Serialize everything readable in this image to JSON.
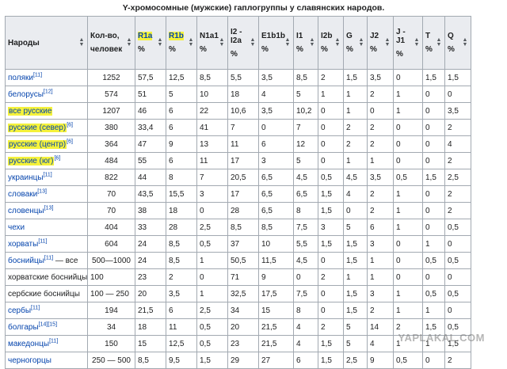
{
  "caption": "Y-хромосомные (мужские) гаплогруппы у славянских народов.",
  "headers": [
    {
      "label": "Народы",
      "unit": ""
    },
    {
      "label": "Кол-во,",
      "unit": "человек"
    },
    {
      "label": "R1a",
      "unit": "%",
      "highlight": true
    },
    {
      "label": "R1b",
      "unit": "%",
      "highlight": true
    },
    {
      "label": "N1a1",
      "unit": "%"
    },
    {
      "label": "I2 -",
      "label2": "I2a",
      "unit": "%"
    },
    {
      "label": "E1b1b",
      "unit": "%"
    },
    {
      "label": "I1",
      "unit": "%"
    },
    {
      "label": "I2b",
      "unit": "%"
    },
    {
      "label": "G",
      "unit": "%"
    },
    {
      "label": "J2",
      "unit": "%"
    },
    {
      "label": "J -",
      "label2": "J1",
      "unit": "%"
    },
    {
      "label": "T",
      "unit": "%"
    },
    {
      "label": "Q",
      "unit": "%"
    }
  ],
  "rows": [
    {
      "name": "поляки",
      "ref": "[11]",
      "hl": false,
      "count": "1252",
      "v": [
        "57,5",
        "12,5",
        "8,5",
        "5,5",
        "3,5",
        "8,5",
        "2",
        "1,5",
        "3,5",
        "0",
        "1,5",
        "1,5"
      ]
    },
    {
      "name": "белорусы",
      "ref": "[12]",
      "hl": false,
      "count": "574",
      "v": [
        "51",
        "5",
        "10",
        "18",
        "4",
        "5",
        "1",
        "1",
        "2",
        "1",
        "0",
        "0"
      ]
    },
    {
      "name": "все русские",
      "ref": "",
      "hl": true,
      "count": "1207",
      "v": [
        "46",
        "6",
        "22",
        "10,6",
        "3,5",
        "10,2",
        "0",
        "1",
        "0",
        "1",
        "0",
        "3,5"
      ]
    },
    {
      "name": "русские (север)",
      "ref": "[6]",
      "hl": true,
      "count": "380",
      "v": [
        "33,4",
        "6",
        "41",
        "7",
        "0",
        "7",
        "0",
        "2",
        "2",
        "0",
        "0",
        "2"
      ]
    },
    {
      "name": "русские (центр)",
      "ref": "[6]",
      "hl": true,
      "count": "364",
      "v": [
        "47",
        "9",
        "13",
        "11",
        "6",
        "12",
        "0",
        "2",
        "2",
        "0",
        "0",
        "4"
      ]
    },
    {
      "name": "русские (юг)",
      "ref": "[6]",
      "hl": true,
      "count": "484",
      "v": [
        "55",
        "6",
        "11",
        "17",
        "3",
        "5",
        "0",
        "1",
        "1",
        "0",
        "0",
        "2"
      ]
    },
    {
      "name": "украинцы",
      "ref": "[11]",
      "hl": false,
      "count": "822",
      "v": [
        "44",
        "8",
        "7",
        "20,5",
        "6,5",
        "4,5",
        "0,5",
        "4,5",
        "3,5",
        "0,5",
        "1,5",
        "2,5"
      ]
    },
    {
      "name": "словаки",
      "ref": "[13]",
      "hl": false,
      "count": "70",
      "v": [
        "43,5",
        "15,5",
        "3",
        "17",
        "6,5",
        "6,5",
        "1,5",
        "4",
        "2",
        "1",
        "0",
        "2"
      ]
    },
    {
      "name": "словенцы",
      "ref": "[13]",
      "hl": false,
      "count": "70",
      "v": [
        "38",
        "18",
        "0",
        "28",
        "6,5",
        "8",
        "1,5",
        "0",
        "2",
        "1",
        "0",
        "2"
      ]
    },
    {
      "name": "чехи",
      "ref": "",
      "hl": false,
      "count": "404",
      "v": [
        "33",
        "28",
        "2,5",
        "8,5",
        "8,5",
        "7,5",
        "3",
        "5",
        "6",
        "1",
        "0",
        "0,5"
      ]
    },
    {
      "name": "хорваты",
      "ref": "[11]",
      "hl": false,
      "count": "604",
      "v": [
        "24",
        "8,5",
        "0,5",
        "37",
        "10",
        "5,5",
        "1,5",
        "1,5",
        "3",
        "0",
        "1",
        "0"
      ]
    },
    {
      "name": "боснийцы",
      "ref": "[11]",
      "suffix": " — все",
      "hl": false,
      "count": "500—1000",
      "v": [
        "24",
        "8,5",
        "1",
        "50,5",
        "11,5",
        "4,5",
        "0",
        "1,5",
        "1",
        "0",
        "0,5",
        "0,5"
      ]
    },
    {
      "name": "хорватские боснийцы",
      "ref": "",
      "plain": true,
      "hl": false,
      "count": "100",
      "v": [
        "23",
        "2",
        "0",
        "71",
        "9",
        "0",
        "2",
        "1",
        "1",
        "0",
        "0",
        "0"
      ]
    },
    {
      "name": "сербские боснийцы",
      "ref": "",
      "plain": true,
      "hl": false,
      "count": "100 — 250",
      "v": [
        "20",
        "3,5",
        "1",
        "32,5",
        "17,5",
        "7,5",
        "0",
        "1,5",
        "3",
        "1",
        "0,5",
        "0,5"
      ]
    },
    {
      "name": "сербы",
      "ref": "[11]",
      "hl": false,
      "count": "194",
      "v": [
        "21,5",
        "6",
        "2,5",
        "34",
        "15",
        "8",
        "0",
        "1,5",
        "2",
        "1",
        "1",
        "0"
      ]
    },
    {
      "name": "болгары",
      "ref": "[14][15]",
      "hl": false,
      "count": "34",
      "v": [
        "18",
        "11",
        "0,5",
        "20",
        "21,5",
        "4",
        "2",
        "5",
        "14",
        "2",
        "1,5",
        "0,5"
      ]
    },
    {
      "name": "македонцы",
      "ref": "[11]",
      "hl": false,
      "count": "150",
      "v": [
        "15",
        "12,5",
        "0,5",
        "23",
        "21,5",
        "4",
        "1,5",
        "5",
        "4",
        "1",
        "1",
        "1,5"
      ]
    },
    {
      "name": "черногорцы",
      "ref": "",
      "hl": false,
      "count": "250 — 500",
      "v": [
        "8,5",
        "9,5",
        "1,5",
        "29",
        "27",
        "6",
        "1,5",
        "2,5",
        "9",
        "0,5",
        "0",
        "2"
      ]
    }
  ],
  "watermark": "YAPLAKAL.COM",
  "sort_icon": "sort-arrows-icon"
}
